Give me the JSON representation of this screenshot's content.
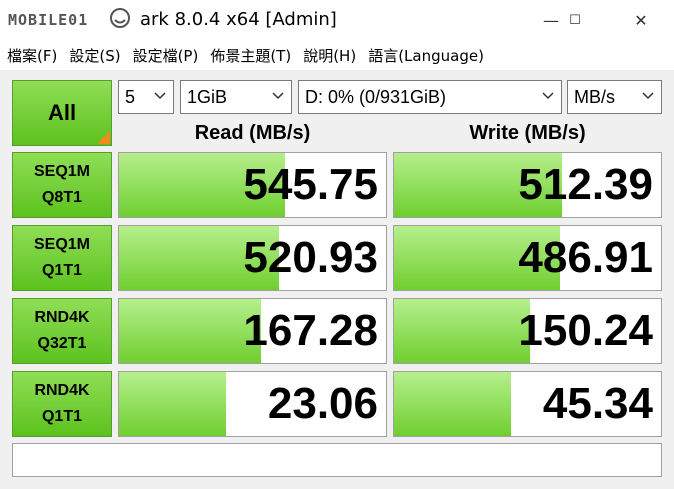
{
  "window": {
    "title": "ark 8.0.4 x64 [Admin]",
    "logo_text": "CrystalDiskMark",
    "minimize_glyph": "—",
    "maximize_glyph": "☐",
    "close_glyph": "✕"
  },
  "menu": [
    "檔案(F)",
    "設定(S)",
    "設定檔(P)",
    "佈景主題(T)",
    "說明(H)",
    "語言(Language)"
  ],
  "controls": {
    "all_label": "All",
    "count": "5",
    "size": "1GiB",
    "drive": "D: 0% (0/931GiB)",
    "unit": "MB/s"
  },
  "headers": {
    "read": "Read (MB/s)",
    "write": "Write (MB/s)"
  },
  "tests": [
    {
      "line1": "SEQ1M",
      "line2": "Q8T1",
      "read": "545.75",
      "write": "512.39",
      "read_fill": 0.62,
      "write_fill": 0.63
    },
    {
      "line1": "SEQ1M",
      "line2": "Q1T1",
      "read": "520.93",
      "write": "486.91",
      "read_fill": 0.6,
      "write_fill": 0.62
    },
    {
      "line1": "RND4K",
      "line2": "Q32T1",
      "read": "167.28",
      "write": "150.24",
      "read_fill": 0.53,
      "write_fill": 0.51
    },
    {
      "line1": "RND4K",
      "line2": "Q1T1",
      "read": "23.06",
      "write": "45.34",
      "read_fill": 0.4,
      "write_fill": 0.44
    }
  ],
  "status_text": "",
  "colors": {
    "accent_green": "#6fcf2f",
    "corner_orange": "#f08a1c"
  }
}
